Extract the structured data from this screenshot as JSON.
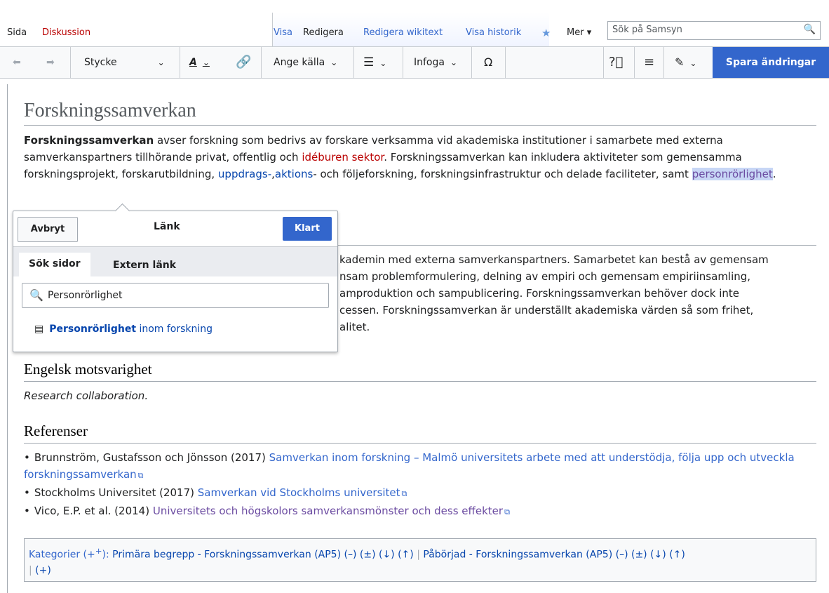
{
  "tabs": {
    "sida": "Sida",
    "diskussion": "Diskussion",
    "visa": "Visa",
    "redigera": "Redigera",
    "redigera_wikitext": "Redigera wikitext",
    "visa_historik": "Visa historik",
    "mer": "Mer"
  },
  "search": {
    "placeholder": "Sök på Samsyn"
  },
  "toolbar": {
    "paragraph": "Stycke",
    "cite": "Ange källa",
    "insert": "Infoga",
    "omega": "Ω",
    "save": "Spara ändringar"
  },
  "article": {
    "title": "Forskningssamverkan",
    "p1_bold": "Forskningssamverkan",
    "p1_a": " avser forskning som bedrivs av forskare verksamma vid akademiska institutioner i samarbete med externa samverkanspartners tillhörande privat, offentlig och ",
    "p1_link_red": "idéburen sektor",
    "p1_b": ". Forskningssamverkan kan inkludera aktiviteter som gemensamma forskningsprojekt, forskarutbildning, ",
    "p1_link1": "uppdrags-",
    "p1_c": ",",
    "p1_link2": "aktions",
    "p1_d": "- och följeforskning, forskningsinfrastruktur och delade faciliteter, samt ",
    "p1_sel": "personrörlighet",
    "p1_end": ".",
    "p2_lines": [
      "kademin med externa samverkanspartners. Samarbetet kan bestå av gemensam",
      "nsam problemformulering, delning av empiri och gemensam empiriinsamling,",
      "amproduktion och sampublicering. Forskningssamverkan behöver dock inte",
      "cessen. Forskningssamverkan är underställt akademiska värden så som frihet,",
      "alitet."
    ],
    "h_english": "Engelsk motsvarighet",
    "english": "Research collaboration.",
    "h_refs": "Referenser",
    "refs": [
      {
        "text": "Brunnström, Gustafsson och Jönsson (2017) ",
        "link": "Samverkan inom forskning – Malmö universitets arbete med att understödja, följa upp och utveckla forskningssamverkan"
      },
      {
        "text": "Stockholms Universitet (2017) ",
        "link": "Samverkan vid Stockholms universitet"
      },
      {
        "text": "Vico, E.P. et al. (2014) ",
        "link": "Universitets och högskolors samverkansmönster och dess effekter"
      }
    ],
    "categories_label": "Kategorier (+",
    "categories_sup": "+",
    "categories_close": "):",
    "cat1": "Primära begrepp - Forskningssamverkan (AP5)",
    "cat_ops": "(–) (±) (↓) (↑)",
    "cat2": "Påbörjad - Forskningssamverkan (AP5)",
    "cat_add": "(+)"
  },
  "popup": {
    "cancel": "Avbryt",
    "title": "Länk",
    "done": "Klart",
    "tab_search": "Sök sidor",
    "tab_external": "Extern länk",
    "input_value": "Personrörlighet",
    "result_bold": "Personrörlighet",
    "result_rest": " inom forskning"
  }
}
